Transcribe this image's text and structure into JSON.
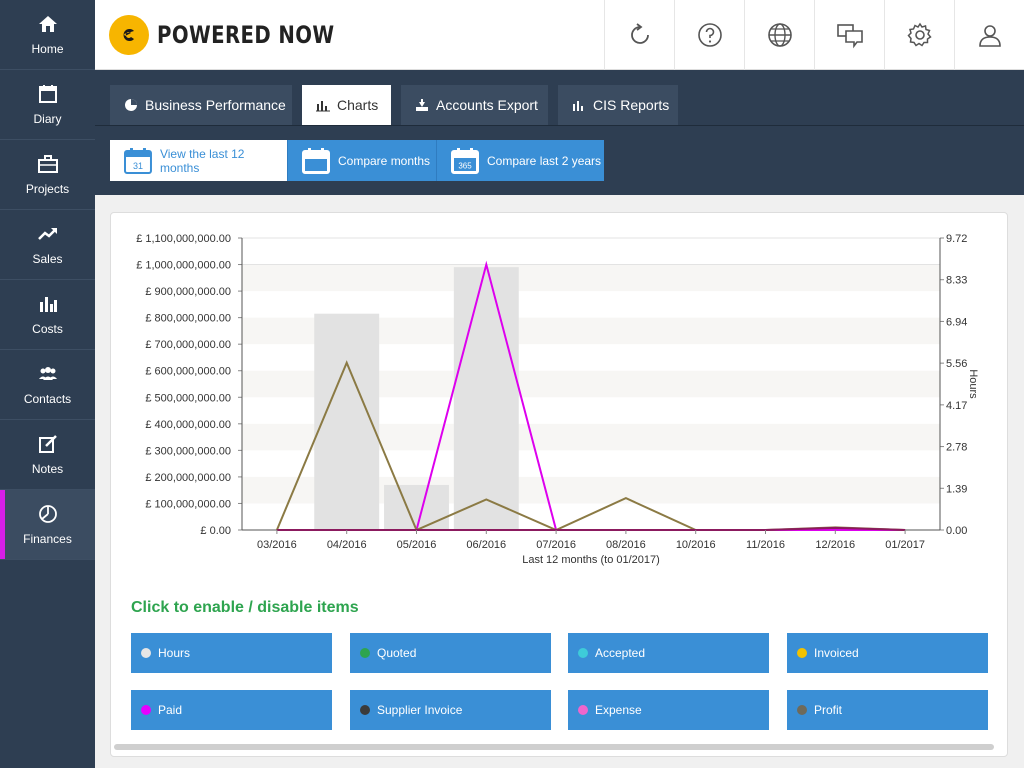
{
  "sidebar": {
    "items": [
      {
        "label": "Home",
        "icon": "home-icon"
      },
      {
        "label": "Diary",
        "icon": "calendar-icon"
      },
      {
        "label": "Projects",
        "icon": "briefcase-icon"
      },
      {
        "label": "Sales",
        "icon": "trend-icon"
      },
      {
        "label": "Costs",
        "icon": "bar-chart-icon"
      },
      {
        "label": "Contacts",
        "icon": "people-icon"
      },
      {
        "label": "Notes",
        "icon": "note-edit-icon"
      },
      {
        "label": "Finances",
        "icon": "pie-chart-icon",
        "active": true
      }
    ]
  },
  "header": {
    "logo_text": "POWERED NOW",
    "buttons": [
      "refresh-icon",
      "help-icon",
      "globe-icon",
      "chat-icon",
      "gear-icon",
      "user-icon"
    ]
  },
  "tabs": [
    {
      "label": "Business Performance"
    },
    {
      "label": "Charts",
      "active": true
    },
    {
      "label": "Accounts Export"
    },
    {
      "label": "CIS Reports"
    }
  ],
  "subtabs": [
    {
      "label": "View the last 12 months",
      "cal_text": "31",
      "active": true
    },
    {
      "label": "Compare months",
      "cal_text": ""
    },
    {
      "label": "Compare last 2 years",
      "cal_text": "365"
    }
  ],
  "chart_data": {
    "type": "bar",
    "xlabel": "Last 12 months (to 01/2017)",
    "categories": [
      "03/2016",
      "04/2016",
      "05/2016",
      "06/2016",
      "07/2016",
      "08/2016",
      "10/2016",
      "11/2016",
      "12/2016",
      "01/2017"
    ],
    "left_ticks": [
      "£ 0.00",
      "£ 100,000,000.00",
      "£ 200,000,000.00",
      "£ 300,000,000.00",
      "£ 400,000,000.00",
      "£ 500,000,000.00",
      "£ 600,000,000.00",
      "£ 700,000,000.00",
      "£ 800,000,000.00",
      "£ 900,000,000.00",
      "£ 1,000,000,000.00",
      "£ 1,100,000,000.00"
    ],
    "right_ticks": [
      "0.00",
      "1.39",
      "2.78",
      "4.17",
      "5.56",
      "6.94",
      "8.33",
      "9.72"
    ],
    "ylabel_right": "Hours",
    "ylim_left": [
      0,
      1100000000
    ],
    "ylim_right": [
      0,
      9.72
    ],
    "series": [
      {
        "name": "Hours",
        "kind": "bar",
        "axis": "right",
        "color": "#e2e2e2",
        "values": [
          0,
          7.2,
          1.5,
          8.75,
          0,
          0,
          0,
          0,
          0,
          0
        ]
      },
      {
        "name": "Paid",
        "kind": "line",
        "axis": "left",
        "color": "#dd00ee",
        "values": [
          0,
          0,
          0,
          1000000000,
          0,
          0,
          0,
          0,
          0,
          0
        ]
      },
      {
        "name": "Profit",
        "kind": "line",
        "axis": "left",
        "color": "#8b7a44",
        "values": [
          0,
          630000000,
          0,
          115000000,
          0,
          120000000,
          0,
          0,
          10000000,
          0
        ]
      },
      {
        "name": "Expense",
        "kind": "line",
        "axis": "left",
        "color": "#8b1a5e",
        "values": [
          0,
          0,
          0,
          0,
          0,
          0,
          0,
          0,
          8000000,
          0
        ]
      }
    ]
  },
  "legend": {
    "title": "Click to enable / disable items",
    "items": [
      {
        "label": "Hours",
        "color": "#e6e6e6"
      },
      {
        "label": "Quoted",
        "color": "#2ea44f"
      },
      {
        "label": "Accepted",
        "color": "#3ecbd9"
      },
      {
        "label": "Invoiced",
        "color": "#f2c200"
      },
      {
        "label": "Paid",
        "color": "#e600ff"
      },
      {
        "label": "Supplier Invoice",
        "color": "#3b3b3b"
      },
      {
        "label": "Expense",
        "color": "#ee66cc"
      },
      {
        "label": "Profit",
        "color": "#6e6a5a"
      }
    ]
  }
}
